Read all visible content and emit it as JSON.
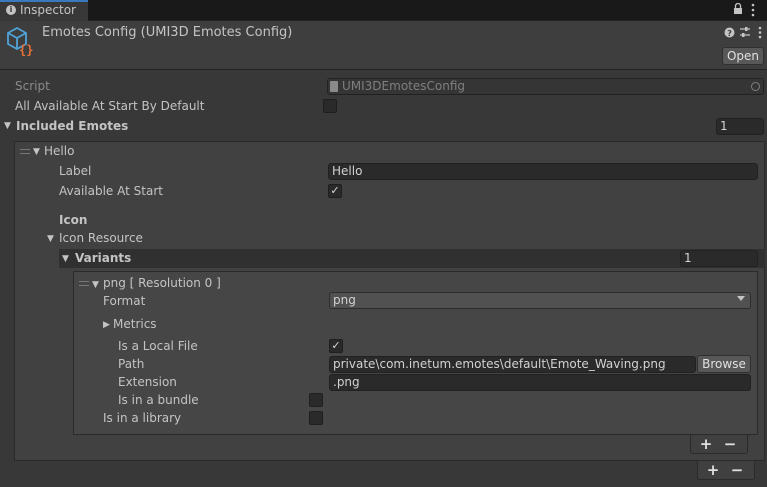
{
  "tab": {
    "label": "Inspector"
  },
  "header": {
    "title": "Emotes Config (UMI3D Emotes Config)",
    "open_label": "Open"
  },
  "script": {
    "label": "Script",
    "value": "UMI3DEmotesConfig"
  },
  "all_available": {
    "label": "All Available At Start By Default",
    "checked": false
  },
  "included": {
    "label": "Included Emotes",
    "count": "1"
  },
  "hello": {
    "title": "Hello",
    "label_label": "Label",
    "label_value": "Hello",
    "available_label": "Available At Start",
    "available_checked": true,
    "icon_label": "Icon",
    "icon_resource_label": "Icon Resource",
    "variants_label": "Variants",
    "variants_count": "1"
  },
  "png": {
    "title": "png [ Resolution 0 ]",
    "format_label": "Format",
    "format_value": "png",
    "metrics_label": "Metrics",
    "local_label": "Is a Local File",
    "local_checked": true,
    "path_label": "Path",
    "path_value": "private\\com.inetum.emotes\\default\\Emote_Waving.png",
    "browse_label": "Browse",
    "extension_label": "Extension",
    "extension_value": ".png",
    "bundle_label": "Is in a bundle",
    "bundle_checked": false,
    "library_label": "Is in a library",
    "library_checked": false
  },
  "list_controls": {
    "plus": "+",
    "minus": "−"
  },
  "colors": {
    "tab_accent": "#3a79bb",
    "icon_blue": "#4fa3d9",
    "icon_orange": "#e8703a"
  }
}
